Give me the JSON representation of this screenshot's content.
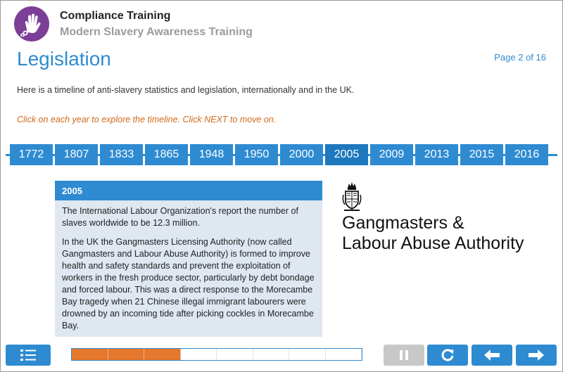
{
  "header": {
    "title": "Compliance Training",
    "subtitle": "Modern Slavery Awareness Training",
    "logo_icon": "hand-with-broken-chain-icon"
  },
  "page": {
    "heading": "Legislation",
    "counter": "Page 2 of 16",
    "intro": "Here is a timeline of anti-slavery statistics and legislation, internationally and in the UK.",
    "instruction": "Click on each year to explore the timeline. Click NEXT to move on."
  },
  "timeline": {
    "years": [
      "1772",
      "1807",
      "1833",
      "1865",
      "1948",
      "1950",
      "2000",
      "2005",
      "2009",
      "2013",
      "2015",
      "2016"
    ],
    "selected": "2005"
  },
  "panel": {
    "title": "2005",
    "paragraph_1": "The International Labour Organization's report the number of slaves worldwide to be 12.3 million.",
    "paragraph_2": "In the UK the Gangmasters Licensing Authority (now called Gangmasters and Labour Abuse Authority) is formed to improve health and safety standards and prevent the exploitation of workers in the fresh produce sector, particularly by debt bondage and forced labour. This was a direct response to the Morecambe Bay tragedy when 21 Chinese illegal immigrant labourers were drowned by an incoming tide after picking cockles in Morecambe Bay."
  },
  "organisation": {
    "line_1": "Gangmasters &",
    "line_2": "Labour Abuse Authority",
    "crest_icon": "royal-crest-icon"
  },
  "footer": {
    "progress_fraction": 0.4,
    "progress_segments": 8,
    "buttons": {
      "menu_icon": "menu-list-icon",
      "pause_icon": "pause-icon",
      "replay_icon": "replay-icon",
      "back_icon": "arrow-left-icon",
      "next_icon": "arrow-right-icon"
    }
  },
  "colors": {
    "accent": "#2e8bd1",
    "brand_purple": "#7b3f98",
    "instruction": "#d16a1a",
    "progress_fill": "#e6782e"
  }
}
